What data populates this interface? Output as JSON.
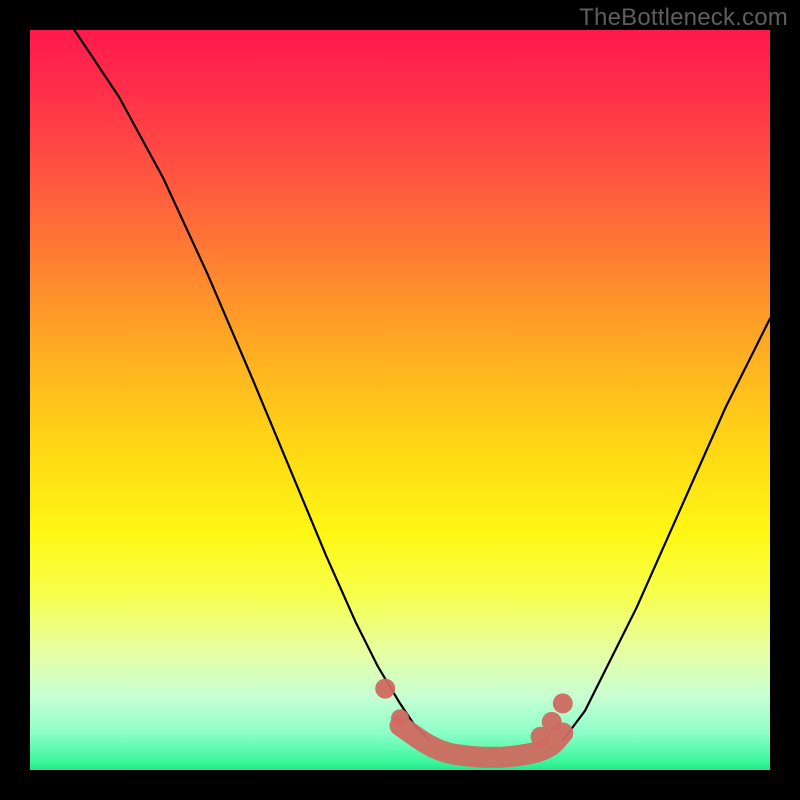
{
  "watermark": "TheBottleneck.com",
  "colors": {
    "page_bg": "#000000",
    "watermark": "#5e5e5e",
    "curve": "#000000",
    "highlight": "#cf6a60",
    "gradient_top": "#ff1a4d",
    "gradient_bottom": "#25e88b"
  },
  "chart_data": {
    "type": "line",
    "title": "",
    "xlabel": "",
    "ylabel": "",
    "xlim_pct": [
      0,
      100
    ],
    "ylim_pct": [
      0,
      100
    ],
    "note": "Axes are unlabeled in the image; x/y values are expressed as percentages of plot width/height measured from top-left (y increases downward).",
    "series": [
      {
        "name": "left_curve",
        "x_pct": [
          6,
          12,
          18,
          24,
          30,
          35,
          40,
          44,
          47,
          50,
          52,
          54
        ],
        "y_pct": [
          0,
          9,
          20,
          33,
          47,
          59,
          71,
          80,
          86,
          91,
          94,
          96
        ]
      },
      {
        "name": "right_curve",
        "x_pct": [
          72,
          75,
          78,
          82,
          86,
          90,
          94,
          98,
          100
        ],
        "y_pct": [
          96,
          92,
          86,
          78,
          69,
          60,
          51,
          43,
          39
        ]
      }
    ],
    "bottom_band": {
      "description": "smoothed highlight connecting the two curve minima near y≈98%",
      "x_pct": [
        50,
        55,
        60,
        65,
        70,
        72
      ],
      "y_pct": [
        94,
        97.5,
        98.3,
        98.3,
        97.3,
        95
      ]
    },
    "marker_dots": [
      {
        "x_pct": 48,
        "y_pct": 89
      },
      {
        "x_pct": 50,
        "y_pct": 93
      },
      {
        "x_pct": 69,
        "y_pct": 95.5
      },
      {
        "x_pct": 70.5,
        "y_pct": 93.5
      },
      {
        "x_pct": 72,
        "y_pct": 91
      }
    ]
  }
}
